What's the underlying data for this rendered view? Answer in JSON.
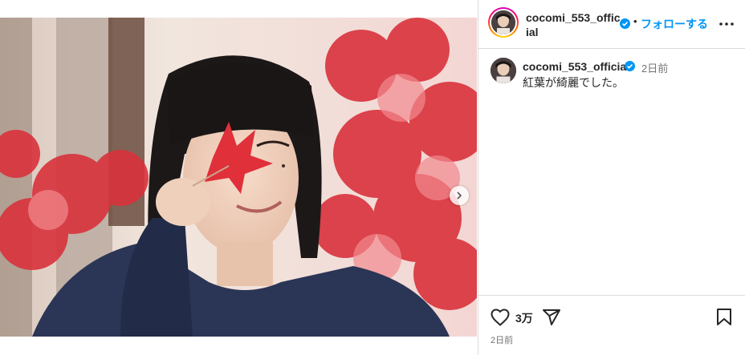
{
  "post": {
    "image_alt": "Photo of a woman holding a red maple leaf over her eye",
    "username": "cocomi_553_official",
    "verified": true,
    "separator": "•",
    "follow_label": "フォローする",
    "more_icon": "more-horizontal-icon"
  },
  "caption": {
    "username": "cocomi_553_official",
    "time": "2日前",
    "text": "紅葉が綺麗でした。"
  },
  "actions": {
    "like_icon": "heart-icon",
    "like_count": "3万",
    "share_icon": "send-icon",
    "save_icon": "bookmark-icon",
    "post_time": "2日前"
  },
  "colors": {
    "accent": "#0095f6",
    "border": "#dbdbdb",
    "secondary_text": "#737373"
  }
}
